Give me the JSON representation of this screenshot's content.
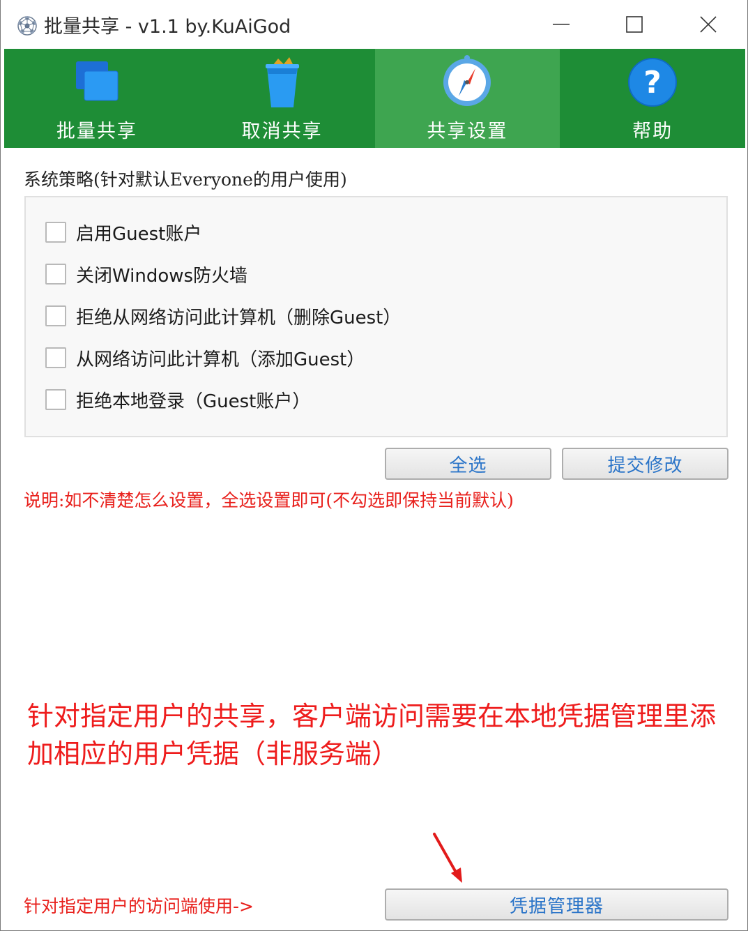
{
  "window": {
    "title": "批量共享 - v1.1 by.KuAiGod",
    "icons": {
      "app": "network-sphere-icon",
      "minimize": "minimize-icon",
      "maximize": "maximize-icon",
      "close": "close-icon"
    }
  },
  "toolbar": {
    "items": [
      {
        "label": "批量共享",
        "icon": "windows-stack-icon",
        "active": false
      },
      {
        "label": "取消共享",
        "icon": "trash-can-icon",
        "active": false
      },
      {
        "label": "共享设置",
        "icon": "compass-icon",
        "active": true
      },
      {
        "label": "帮助",
        "icon": "help-question-icon",
        "active": false
      }
    ]
  },
  "policy": {
    "title": "系统策略(针对默认Everyone的用户使用)",
    "options": [
      {
        "label": "启用Guest账户",
        "checked": false
      },
      {
        "label": "关闭Windows防火墙",
        "checked": false
      },
      {
        "label": "拒绝从网络访问此计算机（删除Guest）",
        "checked": false
      },
      {
        "label": "从网络访问此计算机（添加Guest）",
        "checked": false
      },
      {
        "label": "拒绝本地登录（Guest账户）",
        "checked": false
      }
    ],
    "select_all_label": "全选",
    "submit_label": "提交修改"
  },
  "note": "说明:如不清楚怎么设置，全选设置即可(不勾选即保持当前默认)",
  "annotation": {
    "text": "针对指定用户的共享，客户端访问需要在本地凭据管理里添加相应的用户凭据（非服务端）"
  },
  "footer": {
    "hint": "针对指定用户的访问端使用->",
    "credential_button_label": "凭据管理器"
  },
  "colors": {
    "toolbar_bg": "#1e8d36",
    "toolbar_active": "#3ea550",
    "note_red": "#e8201c",
    "button_text_blue": "#2a74c8"
  }
}
